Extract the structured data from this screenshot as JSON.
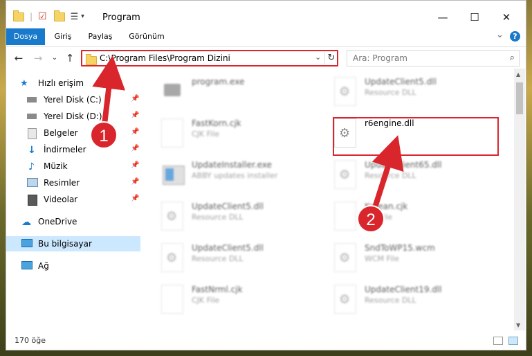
{
  "window": {
    "title": "Program",
    "controls": {
      "minimize": "—",
      "maximize": "☐",
      "close": "✕"
    }
  },
  "ribbon": {
    "tabs": [
      {
        "label": "Dosya",
        "active": true
      },
      {
        "label": "Giriş",
        "active": false
      },
      {
        "label": "Paylaş",
        "active": false
      },
      {
        "label": "Görünüm",
        "active": false
      }
    ],
    "expand": "⌄",
    "help": "?"
  },
  "navigation": {
    "back": "←",
    "forward": "→",
    "recent": "⌄",
    "up": "↑",
    "address_path": "C:\\Program Files\\Program Dizini",
    "dropdown": "⌄",
    "refresh": "↻",
    "search_placeholder": "Ara: Program",
    "search_icon": "⌕"
  },
  "nav_pane": {
    "items": [
      {
        "label": "Hızlı erişim",
        "icon": "star-icon",
        "pinned": false
      },
      {
        "label": "Yerel Disk (C:)",
        "icon": "drive-icon",
        "pinned": true
      },
      {
        "label": "Yerel Disk (D:)",
        "icon": "drive-icon",
        "pinned": true
      },
      {
        "label": "Belgeler",
        "icon": "documents-icon",
        "pinned": true
      },
      {
        "label": "İndirmeler",
        "icon": "download-icon",
        "pinned": true
      },
      {
        "label": "Müzik",
        "icon": "music-icon",
        "pinned": true
      },
      {
        "label": "Resimler",
        "icon": "pictures-icon",
        "pinned": true
      },
      {
        "label": "Videolar",
        "icon": "video-icon",
        "pinned": true
      },
      {
        "label": "OneDrive",
        "icon": "cloud-icon",
        "pinned": false
      },
      {
        "label": "Bu bilgisayar",
        "icon": "computer-icon",
        "pinned": false,
        "selected": true
      },
      {
        "label": "Ağ",
        "icon": "network-icon",
        "pinned": false
      }
    ],
    "pin_glyph": "📌"
  },
  "files": {
    "left": [
      {
        "name": "program.exe",
        "type": ""
      },
      {
        "name": "FastKorn.cjk",
        "type": "CJK File"
      },
      {
        "name": "UpdateInstaller.exe",
        "type": "ABBY updates installer"
      },
      {
        "name": "UpdateClient5.dll",
        "type": "Resource DLL"
      },
      {
        "name": "UpdateClient5.dll",
        "type": "Resource DLL"
      },
      {
        "name": "FastNrml.cjk",
        "type": "CJK File"
      }
    ],
    "right": [
      {
        "name": "UpdateClient5.dll",
        "type": "Resource DLL"
      },
      {
        "name": "r6engine.dll",
        "type": "",
        "highlighted": true
      },
      {
        "name": "UpdateClient65.dll",
        "type": "Resource DLL"
      },
      {
        "name": "Korean.cjk",
        "type": "CJK File"
      },
      {
        "name": "SndToWP15.wcm",
        "type": "WCM File"
      },
      {
        "name": "UpdateClient19.dll",
        "type": "Resource DLL"
      }
    ]
  },
  "status": {
    "item_count": "170 öğe"
  },
  "annotations": {
    "step1": "1",
    "step2": "2",
    "color": "#d9262c"
  }
}
